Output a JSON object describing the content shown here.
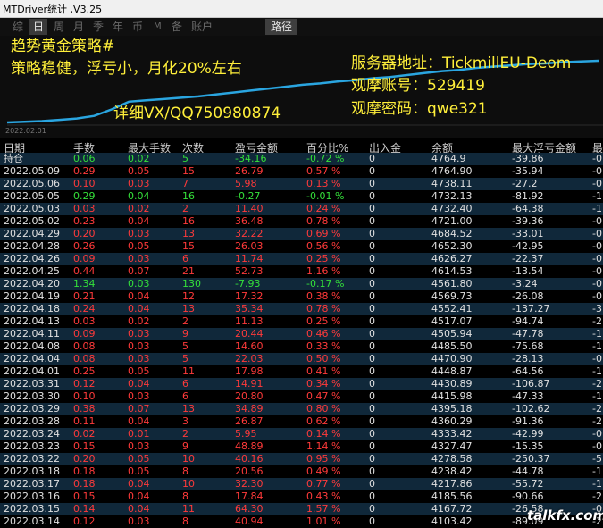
{
  "window": {
    "title": "MTDriver统计 ,V3.25"
  },
  "tabs": {
    "items": [
      {
        "label": "综",
        "active": false
      },
      {
        "label": "日",
        "active": true
      },
      {
        "label": "周",
        "active": false
      },
      {
        "label": "月",
        "active": false
      },
      {
        "label": "季",
        "active": false
      },
      {
        "label": "年",
        "active": false
      },
      {
        "label": "币",
        "active": false
      },
      {
        "label": "M",
        "active": false
      },
      {
        "label": "备",
        "active": false
      },
      {
        "label": "账户",
        "active": false
      }
    ],
    "route": "路径"
  },
  "overlay": {
    "line1": "趋势黄金策略#",
    "line2": "策略稳健，浮亏小，月化20%左右",
    "contact": "详细VX/QQ750980874",
    "server": "服务器地址：TickmillEU-Deom",
    "account": "观摩账号：529419",
    "password": "观摩密码：qwe321"
  },
  "chart_data": {
    "type": "line",
    "x_start_label": "2022.02.01",
    "values": [
      0,
      0.1,
      0.2,
      0.4,
      0.6,
      1.0,
      2.0,
      3.2,
      3.4,
      3.6,
      3.8,
      4.0,
      4.3,
      4.6,
      4.9,
      5.2,
      5.5,
      5.8,
      6.0,
      6.3,
      6.5,
      6.8,
      7.0,
      7.3,
      7.6,
      7.9,
      8.1,
      8.4,
      8.6,
      8.8,
      9.0,
      9.1,
      9.3,
      9.4,
      9.5
    ],
    "color": "#2aa5e0"
  },
  "table": {
    "headers": [
      "日期",
      "手数",
      "最大手数",
      "次数",
      "盈亏金额",
      "百分比%",
      "出入金",
      "余额",
      "最大浮亏金额",
      "最"
    ],
    "rows": [
      {
        "date": "持仓",
        "lots": "0.06",
        "max_lots": "0.02",
        "count": "5",
        "pnl": "-34.16",
        "pct": "-0.72 %",
        "io": "0",
        "balance": "4764.9",
        "max_dd": "-39.86",
        "last": "-0",
        "color": "green"
      },
      {
        "date": "2022.05.09",
        "lots": "0.29",
        "max_lots": "0.05",
        "count": "15",
        "pnl": "26.79",
        "pct": "0.57 %",
        "io": "0",
        "balance": "4764.90",
        "max_dd": "-35.94",
        "last": "-0",
        "color": "red"
      },
      {
        "date": "2022.05.06",
        "lots": "0.10",
        "max_lots": "0.03",
        "count": "7",
        "pnl": "5.98",
        "pct": "0.13 %",
        "io": "0",
        "balance": "4738.11",
        "max_dd": "-27.2",
        "last": "-0",
        "color": "red"
      },
      {
        "date": "2022.05.05",
        "lots": "0.29",
        "max_lots": "0.04",
        "count": "16",
        "pnl": "-0.27",
        "pct": "-0.01 %",
        "io": "0",
        "balance": "4732.13",
        "max_dd": "-81.92",
        "last": "-1",
        "color": "green"
      },
      {
        "date": "2022.05.03",
        "lots": "0.03",
        "max_lots": "0.02",
        "count": "2",
        "pnl": "11.40",
        "pct": "0.24 %",
        "io": "0",
        "balance": "4732.40",
        "max_dd": "-64.38",
        "last": "-1",
        "color": "red"
      },
      {
        "date": "2022.05.02",
        "lots": "0.23",
        "max_lots": "0.04",
        "count": "16",
        "pnl": "36.48",
        "pct": "0.78 %",
        "io": "0",
        "balance": "4721.00",
        "max_dd": "-39.36",
        "last": "-0",
        "color": "red"
      },
      {
        "date": "2022.04.29",
        "lots": "0.20",
        "max_lots": "0.03",
        "count": "13",
        "pnl": "32.22",
        "pct": "0.69 %",
        "io": "0",
        "balance": "4684.52",
        "max_dd": "-33.01",
        "last": "-0",
        "color": "red"
      },
      {
        "date": "2022.04.28",
        "lots": "0.26",
        "max_lots": "0.05",
        "count": "15",
        "pnl": "26.03",
        "pct": "0.56 %",
        "io": "0",
        "balance": "4652.30",
        "max_dd": "-42.95",
        "last": "-0",
        "color": "red"
      },
      {
        "date": "2022.04.26",
        "lots": "0.09",
        "max_lots": "0.03",
        "count": "6",
        "pnl": "11.74",
        "pct": "0.25 %",
        "io": "0",
        "balance": "4626.27",
        "max_dd": "-22.37",
        "last": "-0",
        "color": "red"
      },
      {
        "date": "2022.04.25",
        "lots": "0.44",
        "max_lots": "0.07",
        "count": "21",
        "pnl": "52.73",
        "pct": "1.16 %",
        "io": "0",
        "balance": "4614.53",
        "max_dd": "-13.54",
        "last": "-0",
        "color": "red"
      },
      {
        "date": "2022.04.20",
        "lots": "1.34",
        "max_lots": "0.03",
        "count": "130",
        "pnl": "-7.93",
        "pct": "-0.17 %",
        "io": "0",
        "balance": "4561.80",
        "max_dd": "-3.24",
        "last": "-0",
        "color": "green"
      },
      {
        "date": "2022.04.19",
        "lots": "0.21",
        "max_lots": "0.04",
        "count": "12",
        "pnl": "17.32",
        "pct": "0.38 %",
        "io": "0",
        "balance": "4569.73",
        "max_dd": "-26.08",
        "last": "-0",
        "color": "red"
      },
      {
        "date": "2022.04.18",
        "lots": "0.24",
        "max_lots": "0.04",
        "count": "13",
        "pnl": "35.34",
        "pct": "0.78 %",
        "io": "0",
        "balance": "4552.41",
        "max_dd": "-137.27",
        "last": "-3",
        "color": "red"
      },
      {
        "date": "2022.04.13",
        "lots": "0.03",
        "max_lots": "0.02",
        "count": "2",
        "pnl": "11.13",
        "pct": "0.25 %",
        "io": "0",
        "balance": "4517.07",
        "max_dd": "-94.74",
        "last": "-2",
        "color": "red"
      },
      {
        "date": "2022.04.11",
        "lots": "0.09",
        "max_lots": "0.03",
        "count": "9",
        "pnl": "20.44",
        "pct": "0.46 %",
        "io": "0",
        "balance": "4505.94",
        "max_dd": "-47.78",
        "last": "-1",
        "color": "red"
      },
      {
        "date": "2022.04.08",
        "lots": "0.08",
        "max_lots": "0.03",
        "count": "5",
        "pnl": "14.60",
        "pct": "0.33 %",
        "io": "0",
        "balance": "4485.50",
        "max_dd": "-75.68",
        "last": "-1",
        "color": "red"
      },
      {
        "date": "2022.04.04",
        "lots": "0.08",
        "max_lots": "0.03",
        "count": "5",
        "pnl": "22.03",
        "pct": "0.50 %",
        "io": "0",
        "balance": "4470.90",
        "max_dd": "-28.13",
        "last": "-0",
        "color": "red"
      },
      {
        "date": "2022.04.01",
        "lots": "0.25",
        "max_lots": "0.05",
        "count": "11",
        "pnl": "17.98",
        "pct": "0.41 %",
        "io": "0",
        "balance": "4448.87",
        "max_dd": "-64.56",
        "last": "-1",
        "color": "red"
      },
      {
        "date": "2022.03.31",
        "lots": "0.12",
        "max_lots": "0.04",
        "count": "6",
        "pnl": "14.91",
        "pct": "0.34 %",
        "io": "0",
        "balance": "4430.89",
        "max_dd": "-106.87",
        "last": "-2",
        "color": "red"
      },
      {
        "date": "2022.03.30",
        "lots": "0.10",
        "max_lots": "0.03",
        "count": "6",
        "pnl": "20.80",
        "pct": "0.47 %",
        "io": "0",
        "balance": "4415.98",
        "max_dd": "-47.33",
        "last": "-1",
        "color": "red"
      },
      {
        "date": "2022.03.29",
        "lots": "0.38",
        "max_lots": "0.07",
        "count": "13",
        "pnl": "34.89",
        "pct": "0.80 %",
        "io": "0",
        "balance": "4395.18",
        "max_dd": "-102.62",
        "last": "-2",
        "color": "red"
      },
      {
        "date": "2022.03.28",
        "lots": "0.11",
        "max_lots": "0.04",
        "count": "3",
        "pnl": "26.87",
        "pct": "0.62 %",
        "io": "0",
        "balance": "4360.29",
        "max_dd": "-91.36",
        "last": "-2",
        "color": "red"
      },
      {
        "date": "2022.03.24",
        "lots": "0.02",
        "max_lots": "0.01",
        "count": "2",
        "pnl": "5.95",
        "pct": "0.14 %",
        "io": "0",
        "balance": "4333.42",
        "max_dd": "-42.99",
        "last": "-0",
        "color": "red"
      },
      {
        "date": "2022.03.23",
        "lots": "0.15",
        "max_lots": "0.03",
        "count": "9",
        "pnl": "48.89",
        "pct": "1.14 %",
        "io": "0",
        "balance": "4327.47",
        "max_dd": "-15.35",
        "last": "-0",
        "color": "red"
      },
      {
        "date": "2022.03.22",
        "lots": "0.20",
        "max_lots": "0.05",
        "count": "10",
        "pnl": "40.16",
        "pct": "0.95 %",
        "io": "0",
        "balance": "4278.58",
        "max_dd": "-250.37",
        "last": "-5",
        "color": "red"
      },
      {
        "date": "2022.03.18",
        "lots": "0.18",
        "max_lots": "0.05",
        "count": "8",
        "pnl": "20.56",
        "pct": "0.49 %",
        "io": "0",
        "balance": "4238.42",
        "max_dd": "-44.78",
        "last": "-1",
        "color": "red"
      },
      {
        "date": "2022.03.17",
        "lots": "0.18",
        "max_lots": "0.04",
        "count": "10",
        "pnl": "32.30",
        "pct": "0.77 %",
        "io": "0",
        "balance": "4217.86",
        "max_dd": "-55.72",
        "last": "-1",
        "color": "red"
      },
      {
        "date": "2022.03.16",
        "lots": "0.15",
        "max_lots": "0.04",
        "count": "8",
        "pnl": "17.84",
        "pct": "0.43 %",
        "io": "0",
        "balance": "4185.56",
        "max_dd": "-90.66",
        "last": "-2",
        "color": "red"
      },
      {
        "date": "2022.03.15",
        "lots": "0.14",
        "max_lots": "0.04",
        "count": "11",
        "pnl": "64.30",
        "pct": "1.57 %",
        "io": "0",
        "balance": "4167.72",
        "max_dd": "-26.58",
        "last": "-0",
        "color": "red"
      },
      {
        "date": "2022.03.14",
        "lots": "0.12",
        "max_lots": "0.03",
        "count": "8",
        "pnl": "40.94",
        "pct": "1.01 %",
        "io": "0",
        "balance": "4103.42",
        "max_dd": "-89.09",
        "last": "-2",
        "color": "red"
      }
    ]
  },
  "watermark": "talkfx.com"
}
